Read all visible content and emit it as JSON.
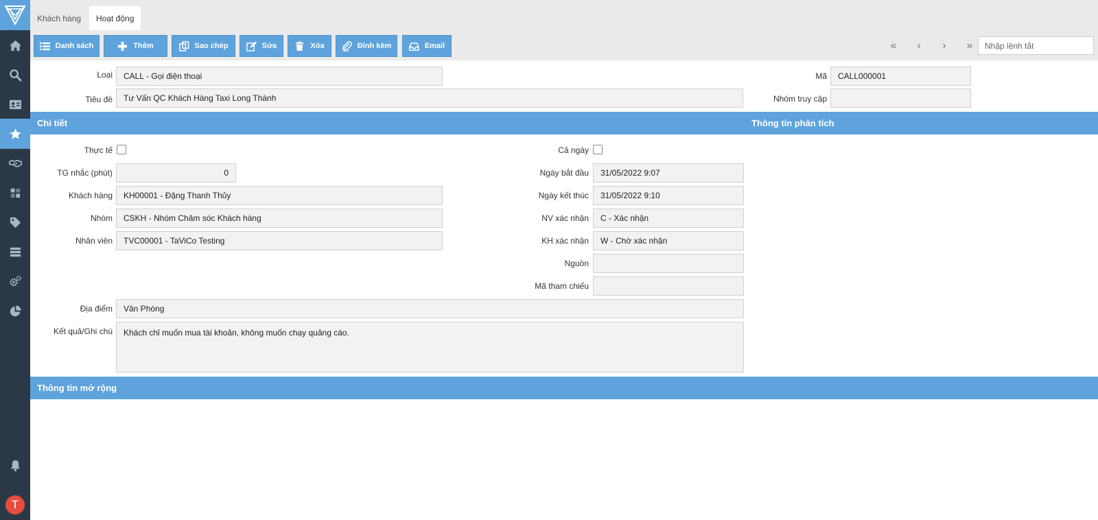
{
  "sidebar": {
    "avatar_letter": "T",
    "icons": [
      "logo-icon",
      "home-icon",
      "search-icon",
      "contact-card-icon",
      "star-icon",
      "handshake-icon",
      "dashboard-icon",
      "tag-icon",
      "server-icon",
      "settings-icon",
      "pie-chart-icon",
      "bell-icon"
    ]
  },
  "tabs": [
    {
      "label": "Khách hàng"
    },
    {
      "label": "Hoạt động"
    }
  ],
  "toolbar": {
    "list_label": "Danh sách",
    "add_label": "Thêm",
    "copy_label": "Sao chép",
    "edit_label": "Sửa",
    "delete_label": "Xóa",
    "attach_label": "Đính kèm",
    "email_label": "Email",
    "command_placeholder": "Nhập lệnh tắt"
  },
  "header": {
    "type_label": "Loại",
    "type_value": "CALL - Gọi điện thoại",
    "title_label": "Tiêu đề",
    "title_value": "Tư Vấn QC Khách Hàng Taxi Long Thành",
    "code_label": "Mã",
    "code_value": "CALL000001",
    "access_group_label": "Nhóm truy cập",
    "access_group_value": ""
  },
  "sections": {
    "detail": "Chi tiết",
    "analysis": "Thông tin phân tích",
    "extended": "Thông tin mở rộng"
  },
  "detail": {
    "actual_label": "Thực tế",
    "actual_checked": false,
    "reminder_label": "TG nhắc (phút)",
    "reminder_value": "0",
    "customer_label": "Khách hàng",
    "customer_value": "KH00001 - Đặng Thanh Thủy",
    "group_label": "Nhóm",
    "group_value": "CSKH - Nhóm Chăm sóc Khách hàng",
    "employee_label": "Nhân viên",
    "employee_value": "TVC00001 - TaViCo Testing",
    "allday_label": "Cả ngày",
    "allday_checked": false,
    "start_label": "Ngày bắt đầu",
    "start_value": "31/05/2022 9:07",
    "end_label": "Ngày kết thúc",
    "end_value": "31/05/2022 9:10",
    "staff_confirm_label": "NV xác nhận",
    "staff_confirm_value": "C - Xác nhận",
    "customer_confirm_label": "KH xác nhận",
    "customer_confirm_value": "W - Chờ xác nhận",
    "source_label": "Nguồn",
    "source_value": "",
    "reference_label": "Mã tham chiếu",
    "reference_value": "",
    "location_label": "Địa điểm",
    "location_value": "Văn Phòng",
    "result_label": "Kết quả/Ghi chú",
    "result_value": "Khách chỉ muốn mua tài khoản, không muốn chạy quảng cáo."
  },
  "colors": {
    "accent": "#5ea3dc",
    "sidebar": "#2b3947",
    "avatar": "#e74c3c"
  }
}
